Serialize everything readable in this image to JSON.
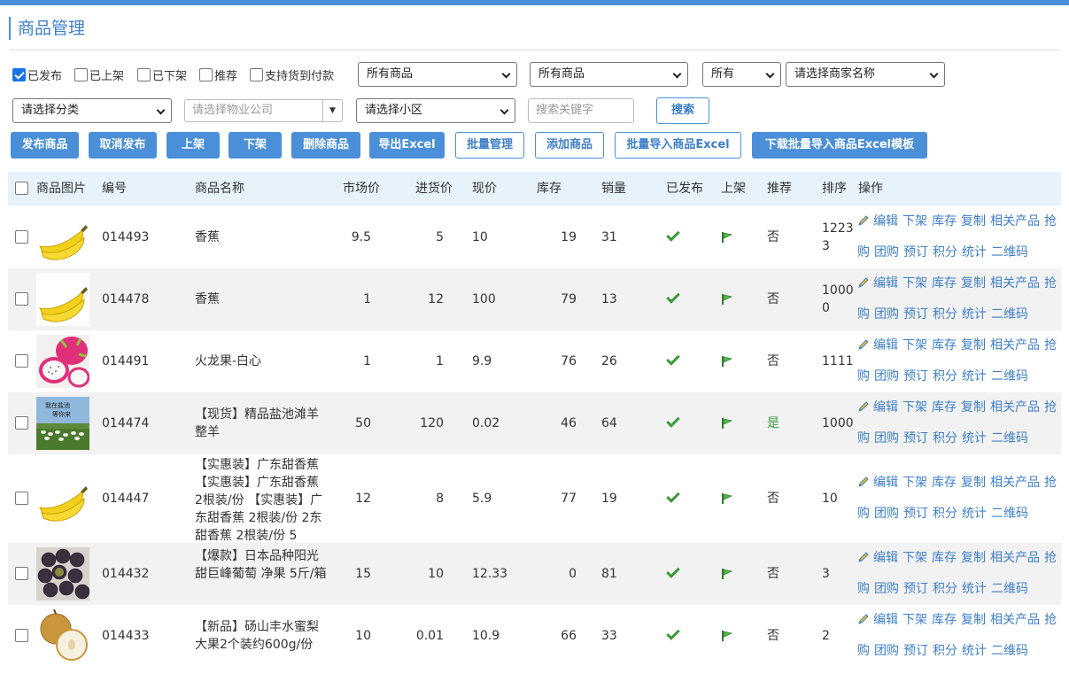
{
  "page_title": "商品管理",
  "filters": {
    "checkboxes": [
      {
        "label": "已发布",
        "checked": true
      },
      {
        "label": "已上架",
        "checked": false
      },
      {
        "label": "已下架",
        "checked": false
      },
      {
        "label": "推荐",
        "checked": false
      },
      {
        "label": "支持货到付款",
        "checked": false
      }
    ],
    "select1": "所有商品",
    "select2": "所有商品",
    "select3": "所有",
    "merchant_select": "请选择商家名称",
    "category_select": "请选择分类",
    "property_company_placeholder": "请选择物业公司",
    "community_select": "请选择小区",
    "keyword_placeholder": "搜索关键字",
    "search_label": "搜索"
  },
  "actions": {
    "publish": "发布商品",
    "unpublish": "取消发布",
    "shelve": "上架",
    "unshelve": "下架",
    "delete": "删除商品",
    "export": "导出Excel",
    "batch_manage": "批量管理",
    "add": "添加商品",
    "batch_import": "批量导入商品Excel",
    "download_template": "下载批量导入商品Excel模板"
  },
  "table": {
    "headers": {
      "image": "商品图片",
      "code": "编号",
      "name": "商品名称",
      "market_price": "市场价",
      "purchase_price": "进货价",
      "current_price": "现价",
      "stock": "库存",
      "sales": "销量",
      "published": "已发布",
      "shelved": "上架",
      "recommend": "推荐",
      "sort": "排序",
      "ops": "操作"
    },
    "ops": [
      "编辑",
      "下架",
      "库存",
      "复制",
      "相关产品",
      "抢购",
      "团购",
      "预订",
      "积分",
      "统计",
      "二维码"
    ],
    "rows": [
      {
        "code": "014493",
        "name": "香蕉",
        "market": "9.5",
        "purchase": "5",
        "price": "10",
        "stock": "19",
        "sales": "31",
        "recommend": "否",
        "sort": "12233",
        "img": "banana-image"
      },
      {
        "code": "014478",
        "name": "香蕉",
        "market": "1",
        "purchase": "12",
        "price": "100",
        "stock": "79",
        "sales": "13",
        "recommend": "否",
        "sort": "10000",
        "img": "banana-image"
      },
      {
        "code": "014491",
        "name": "火龙果-白心",
        "market": "1",
        "purchase": "1",
        "price": "9.9",
        "stock": "76",
        "sales": "26",
        "recommend": "否",
        "sort": "1111",
        "img": "dragonfruit-image"
      },
      {
        "code": "014474",
        "name": "【现货】精品盐池滩羊整羊",
        "market": "50",
        "purchase": "120",
        "price": "0.02",
        "stock": "46",
        "sales": "64",
        "recommend": "是",
        "sort": "1000",
        "img": "sheep-image"
      },
      {
        "code": "014447",
        "name": "【实惠装】广东甜香蕉 【实惠装】广东甜香蕉 2根装/份 【实惠装】广东甜香蕉 2根装/份 2东甜香蕉 2根装/份 5",
        "market": "12",
        "purchase": "8",
        "price": "5.9",
        "stock": "77",
        "sales": "19",
        "recommend": "否",
        "sort": "10",
        "img": "banana-image"
      },
      {
        "code": "014432",
        "name": "【爆款】日本品种阳光甜巨峰葡萄 净果 5斤/箱",
        "market": "15",
        "purchase": "10",
        "price": "12.33",
        "stock": "0",
        "sales": "81",
        "recommend": "否",
        "sort": "3",
        "img": "grape-image"
      },
      {
        "code": "014433",
        "name": "【新品】砀山丰水蜜梨大果2个装约600g/份",
        "market": "10",
        "purchase": "0.01",
        "price": "10.9",
        "stock": "66",
        "sales": "33",
        "recommend": "否",
        "sort": "2",
        "img": "pear-image"
      }
    ]
  },
  "colors": {
    "accent": "#4a8fd8",
    "link": "#3f7fc8",
    "header_bg": "#e7f2fb",
    "alt_row": "#f2f2f2",
    "check_green": "#3a9a3a"
  }
}
